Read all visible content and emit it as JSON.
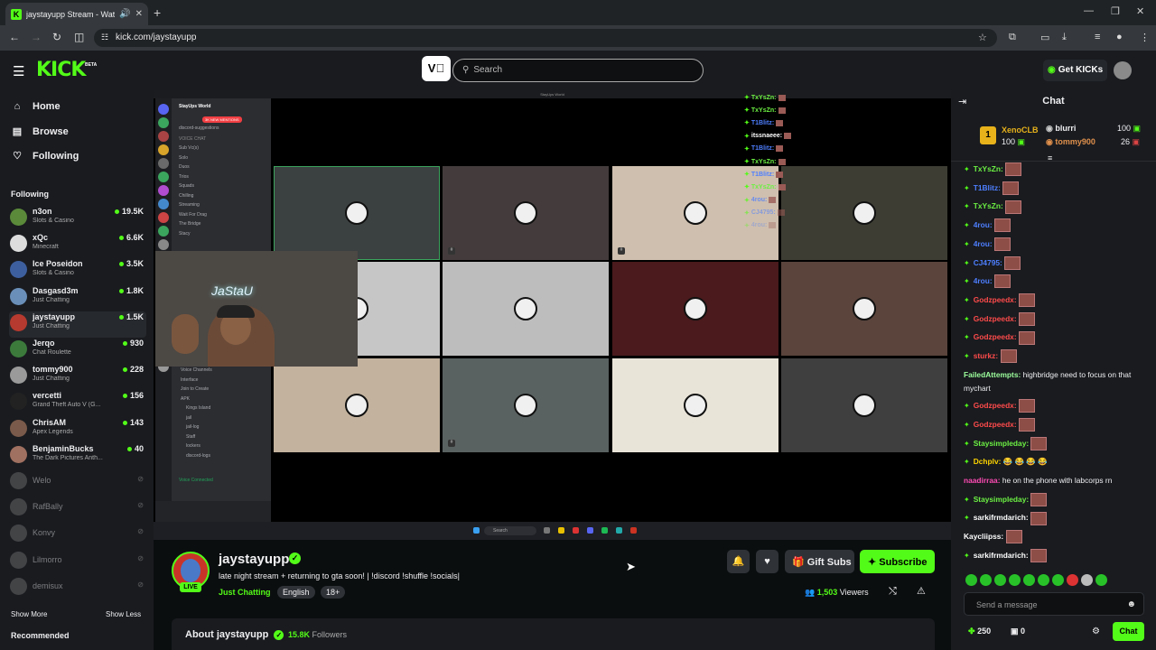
{
  "browser": {
    "tab_title": "jaystayupp Stream - Watch",
    "tab_favicon": "K",
    "new_tab": "+",
    "url": "kick.com/jaystayupp"
  },
  "header": {
    "logo": "KICK",
    "beta": "BETA",
    "search_placeholder": "Search",
    "get_kicks": "Get KICKs"
  },
  "sidebar": {
    "nav": [
      {
        "label": "Home",
        "icon": "home-icon"
      },
      {
        "label": "Browse",
        "icon": "browse-icon"
      },
      {
        "label": "Following",
        "icon": "heart-icon"
      }
    ],
    "following_heading": "Following",
    "channels": [
      {
        "name": "n3on",
        "category": "Slots & Casino",
        "viewers": "19.5K",
        "color": "#5a8a3a"
      },
      {
        "name": "xQc",
        "category": "Minecraft",
        "viewers": "6.6K",
        "color": "#dddddd"
      },
      {
        "name": "Ice Poseidon",
        "category": "Slots & Casino",
        "viewers": "3.5K",
        "color": "#3d5f9e"
      },
      {
        "name": "Dasgasd3m",
        "category": "Just Chatting",
        "viewers": "1.8K",
        "color": "#6a8fb8"
      },
      {
        "name": "jaystayupp",
        "category": "Just Chatting",
        "viewers": "1.5K",
        "color": "#b63a2f"
      },
      {
        "name": "Jerqo",
        "category": "Chat Roulette",
        "viewers": "930",
        "color": "#3b7a3b"
      },
      {
        "name": "tommy900",
        "category": "Just Chatting",
        "viewers": "228",
        "color": "#9a9a9a"
      },
      {
        "name": "vercetti",
        "category": "Grand Theft Auto V (G...",
        "viewers": "156",
        "color": "#222222"
      },
      {
        "name": "ChrisAM",
        "category": "Apex Legends",
        "viewers": "143",
        "color": "#7a5a4a"
      },
      {
        "name": "BenjaminBucks",
        "category": "The Dark Pictures Anth...",
        "viewers": "40",
        "color": "#a07060"
      }
    ],
    "offline": [
      "Welo",
      "RafBally",
      "Konvy",
      "Lilmorro",
      "demisux"
    ],
    "show_more": "Show More",
    "show_less": "Show Less",
    "recommended": "Recommended"
  },
  "video": {
    "window_title": "StayUps World",
    "server_name": "StayUps World",
    "mention_badge": "3K NEW MENTIONS",
    "channels_top": [
      "discord-suggestions"
    ],
    "voice_heading": "VOICE CHAT",
    "voice_channels": [
      "Sub Vc(s)",
      "Solo",
      "Duos",
      "Trios",
      "Squads",
      "Chilling",
      "Streaming",
      "Wait For Drag",
      "The Bridge",
      "Stacy"
    ],
    "voice_bottom": [
      "Voice Channels",
      "Interface",
      "Join to Create",
      "APK",
      "Kings Island",
      "jail",
      "jail-log",
      "Staff",
      "lockers",
      "discord-logs"
    ],
    "voice_connected": "Voice Connected",
    "overlay_names": [
      {
        "name": "TxYsZn:",
        "color": "#6cf043"
      },
      {
        "name": "TxYsZn:",
        "color": "#6cf043"
      },
      {
        "name": "T1Blitz:",
        "color": "#4e7fff"
      },
      {
        "name": "itssnaeee:",
        "color": "#ffffff"
      },
      {
        "name": "T1Blitz:",
        "color": "#4e7fff"
      },
      {
        "name": "TxYsZn:",
        "color": "#6cf043"
      },
      {
        "name": "T1Blitz:",
        "color": "#4e7fff"
      },
      {
        "name": "TxYsZn:",
        "color": "#6cf043"
      },
      {
        "name": "4rou:",
        "color": "#4e7fff"
      },
      {
        "name": "CJ4795:",
        "color": "#4e7fff"
      },
      {
        "name": "4rou:",
        "color": "#4e7fff"
      }
    ],
    "taskbar_search": "Search",
    "grid_tiles": [
      {
        "bg": "#3b4040"
      },
      {
        "bg": "#443c3c"
      },
      {
        "bg": "#cfbfae"
      },
      {
        "bg": "#3d3d34"
      },
      {
        "bg": "#c6c6c6"
      },
      {
        "bg": "#bdbdbd"
      },
      {
        "bg": "#4a1a1c"
      },
      {
        "bg": "#5a443c"
      },
      {
        "bg": "#c3b29d"
      },
      {
        "bg": "#5a6261"
      },
      {
        "bg": "#e9e4d8"
      },
      {
        "bg": "#3f3f3f"
      }
    ]
  },
  "stream": {
    "name": "jaystayupp",
    "live": "LIVE",
    "title": "late night stream + returning to gta soon!  | !discord !shuffle !socials|",
    "category": "Just Chatting",
    "tags": [
      "English",
      "18+"
    ],
    "gift_subs": "Gift Subs",
    "subscribe": "Subscribe",
    "viewers_count": "1,503",
    "viewers_label": "Viewers",
    "about_title": "About jaystayupp",
    "followers_count": "15.8K",
    "followers_label": "Followers"
  },
  "chat": {
    "title": "Chat",
    "leaderboard": {
      "rank": "1",
      "first": {
        "name": "XenoCLB",
        "points": "100"
      },
      "second": {
        "name": "blurri",
        "points": "100"
      },
      "third": {
        "name": "tommy900",
        "points": "26"
      }
    },
    "messages": [
      {
        "user": "TxYsZn:",
        "color": "#6cf043",
        "text": "",
        "emote": true
      },
      {
        "user": "T1Blitz:",
        "color": "#4e7fff",
        "text": "",
        "emote": true
      },
      {
        "user": "TxYsZn:",
        "color": "#6cf043",
        "text": "",
        "emote": true
      },
      {
        "user": "4rou:",
        "color": "#4e7fff",
        "text": "",
        "emote": true
      },
      {
        "user": "4rou:",
        "color": "#4e7fff",
        "text": "",
        "emote": true
      },
      {
        "user": "CJ4795:",
        "color": "#4e7fff",
        "text": "",
        "emote": true
      },
      {
        "user": "4rou:",
        "color": "#4e7fff",
        "text": "",
        "emote": true
      },
      {
        "user": "Godzpeedx:",
        "color": "#ff4b4b",
        "text": "",
        "emote": true
      },
      {
        "user": "Godzpeedx:",
        "color": "#ff4b4b",
        "text": "",
        "emote": true
      },
      {
        "user": "Godzpeedx:",
        "color": "#ff4b4b",
        "text": "",
        "emote": true
      },
      {
        "user": "sturkz:",
        "color": "#ff4b4b",
        "text": "",
        "emote": true
      },
      {
        "user": "FailedAttempts:",
        "color": "#9dff9d",
        "text": "highbridge need to focus on that mychart",
        "emote": false
      },
      {
        "user": "Godzpeedx:",
        "color": "#ff4b4b",
        "text": "",
        "emote": true
      },
      {
        "user": "Godzpeedx:",
        "color": "#ff4b4b",
        "text": "",
        "emote": true
      },
      {
        "user": "Staysimpleday:",
        "color": "#6cf043",
        "text": "",
        "emote": true
      },
      {
        "user": "Dchplv:",
        "color": "#ffd400",
        "text": "😂 😂 😂 😂",
        "emote": false
      },
      {
        "user": "naadirraa:",
        "color": "#ff4bb4",
        "text": "he on the phone with labcorps rn",
        "emote": false
      },
      {
        "user": "Staysimpleday:",
        "color": "#6cf043",
        "text": "",
        "emote": true
      },
      {
        "user": "sarkifrmdarich:",
        "color": "#ffffff",
        "text": "",
        "emote": true
      },
      {
        "user": "Kaycliipss:",
        "color": "#ffffff",
        "text": "",
        "emote": true
      },
      {
        "user": "sarkifrmdarich:",
        "color": "#ffffff",
        "text": "",
        "emote": true
      }
    ],
    "input_placeholder": "Send a message",
    "points": "250",
    "box_points": "0",
    "chat_button": "Chat"
  }
}
